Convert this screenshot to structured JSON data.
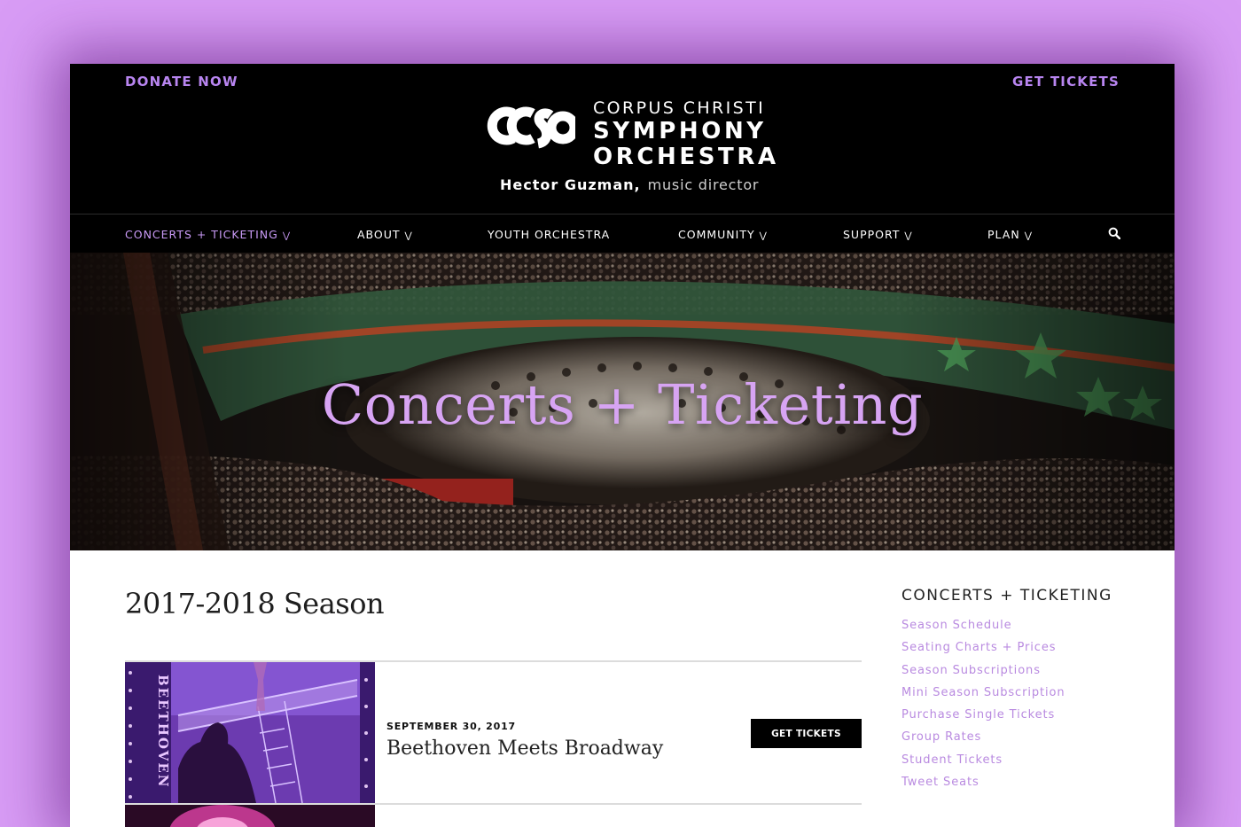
{
  "header": {
    "donate_label": "DONATE NOW",
    "tickets_label": "GET TICKETS",
    "logo_lines": [
      "CORPUS CHRISTI",
      "SYMPHONY",
      "ORCHESTRA"
    ],
    "director_name": "Hector Guzman,",
    "director_role": "music director"
  },
  "nav": {
    "items": [
      {
        "label": "CONCERTS + TICKETING",
        "dropdown": true,
        "active": true
      },
      {
        "label": "ABOUT",
        "dropdown": true
      },
      {
        "label": "YOUTH ORCHESTRA",
        "dropdown": false
      },
      {
        "label": "COMMUNITY",
        "dropdown": true
      },
      {
        "label": "SUPPORT",
        "dropdown": true
      },
      {
        "label": "PLAN",
        "dropdown": true
      }
    ],
    "chevron": "»",
    "search_icon": "search-icon"
  },
  "hero": {
    "title": "Concerts + Ticketing"
  },
  "main": {
    "season_title": "2017-2018 Season",
    "events": [
      {
        "date": "SEPTEMBER 30, 2017",
        "name": "Beethoven Meets Broadway",
        "button": "GET TICKETS",
        "thumb_text": "BEETHOVEN"
      }
    ]
  },
  "sidebar": {
    "title": "CONCERTS + TICKETING",
    "links": [
      "Season Schedule",
      "Seating Charts + Prices",
      "Season Subscriptions",
      "Mini Season Subscription",
      "Purchase Single Tickets",
      "Group Rates",
      "Student Tickets",
      "Tweet Seats"
    ]
  },
  "colors": {
    "accent": "#b98ae0",
    "nav_active": "#c99af6",
    "hero_title": "#d7a4f3",
    "background": "#d89cf5"
  }
}
